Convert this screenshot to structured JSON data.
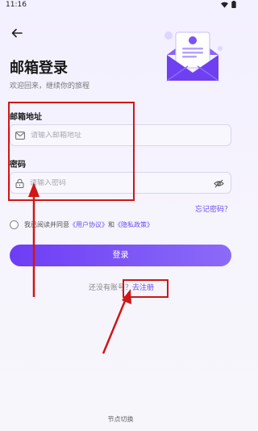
{
  "status": {
    "time": "11:16"
  },
  "header": {
    "title": "邮箱登录",
    "subtitle": "欢迎回来，继续你的旅程"
  },
  "form": {
    "email_label": "邮箱地址",
    "email_placeholder": "请输入邮箱地址",
    "password_label": "密码",
    "password_placeholder": "请输入密码",
    "forgot_password": "忘记密码？"
  },
  "agreement": {
    "prefix": "我已阅读并同意",
    "user_agreement": "《用户协议》",
    "and": "和",
    "privacy_policy": "《隐私政策》"
  },
  "login_button": "登录",
  "register": {
    "prompt": "还没有账号？",
    "link": "去注册"
  },
  "footer": {
    "node_switch": "节点切换"
  },
  "colors": {
    "accent": "#6b4cf0",
    "button_start": "#6d3df5",
    "button_end": "#8b6bf8",
    "annotation_red": "#d01616"
  }
}
